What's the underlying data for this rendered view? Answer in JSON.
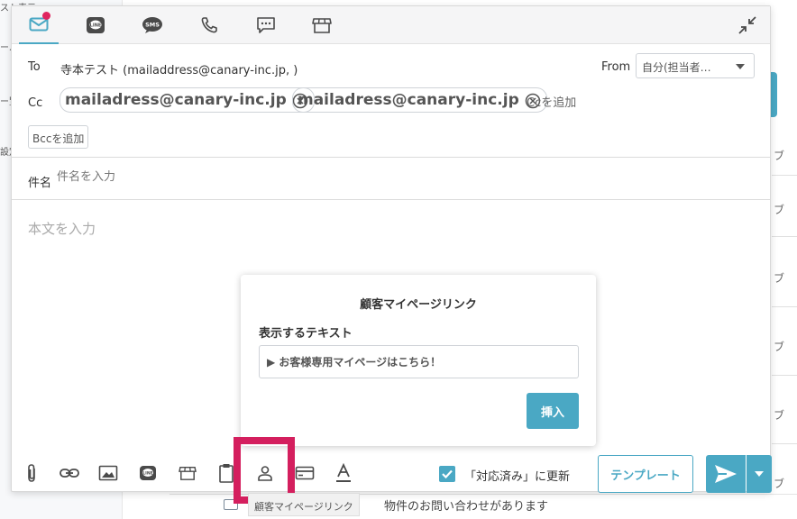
{
  "background": {
    "left_fragments": [
      "スト表示",
      "ール",
      "ー覧",
      "設定"
    ],
    "row_fragments": [
      "ブ",
      "ブ",
      "ブ",
      "ブ",
      "ブ",
      "ブ"
    ],
    "bottom_link": "物件のお問い合わせがあります"
  },
  "composer": {
    "tabs": [
      {
        "name": "email",
        "icon": "mail-icon"
      },
      {
        "name": "line",
        "icon": "line-icon"
      },
      {
        "name": "sms",
        "icon": "sms-icon"
      },
      {
        "name": "phone",
        "icon": "phone-icon"
      },
      {
        "name": "chat",
        "icon": "chat-icon"
      },
      {
        "name": "store",
        "icon": "store-icon"
      }
    ],
    "to_label": "To",
    "to_value": "寺本テスト (mailaddress@canary-inc.jp, )",
    "from_label": "From",
    "from_value": "自分(担当者…",
    "cc_label": "Cc",
    "cc_chips": [
      "mailadress@canary-inc.jp",
      "mailadress@canary-inc.jp"
    ],
    "add_cc": "Ccを追加",
    "add_bcc": "Bccを追加",
    "subject_label": "件名",
    "subject_placeholder": "件名を入力",
    "body_placeholder": "本文を入力",
    "popup": {
      "title": "顧客マイページリンク",
      "field_label": "表示するテキスト",
      "field_value": "▶︎ お客様専用マイページはこちら！",
      "insert_label": "挿入"
    },
    "tooltip": "顧客マイページリンク",
    "checkbox_label": "「対応済み」に更新",
    "checkbox_checked": true,
    "template_label": "テンプレート"
  },
  "colors": {
    "accent": "#4aa8c4",
    "highlight": "#d41f5e",
    "notify": "#e0245e"
  }
}
